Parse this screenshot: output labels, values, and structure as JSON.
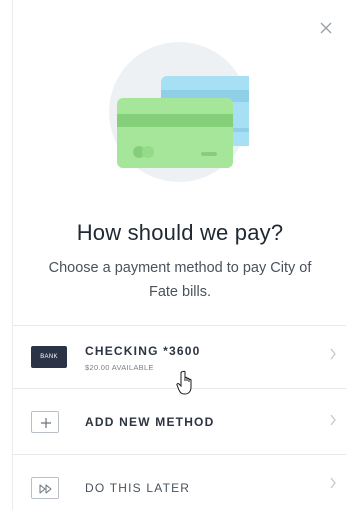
{
  "dialog": {
    "title": "How should we pay?",
    "subtitle": "Choose a payment method to pay City of Fate bills."
  },
  "methods": [
    {
      "badge": "BANK",
      "label": "CHECKING *3600",
      "detail": "$20.00 AVAILABLE"
    }
  ],
  "add_method": {
    "label": "ADD NEW METHOD"
  },
  "later": {
    "label": "DO THIS LATER"
  },
  "colors": {
    "card_front": "#a6e69a",
    "card_back": "#a7dff4",
    "bank_badge": "#2b3346",
    "circle_bg": "#eef1f4"
  },
  "icons": {
    "close": "close-icon",
    "add": "plus-icon",
    "later": "fast-forward-icon",
    "chevron": "chevron-right-icon",
    "cursor": "hand-pointer-icon"
  }
}
